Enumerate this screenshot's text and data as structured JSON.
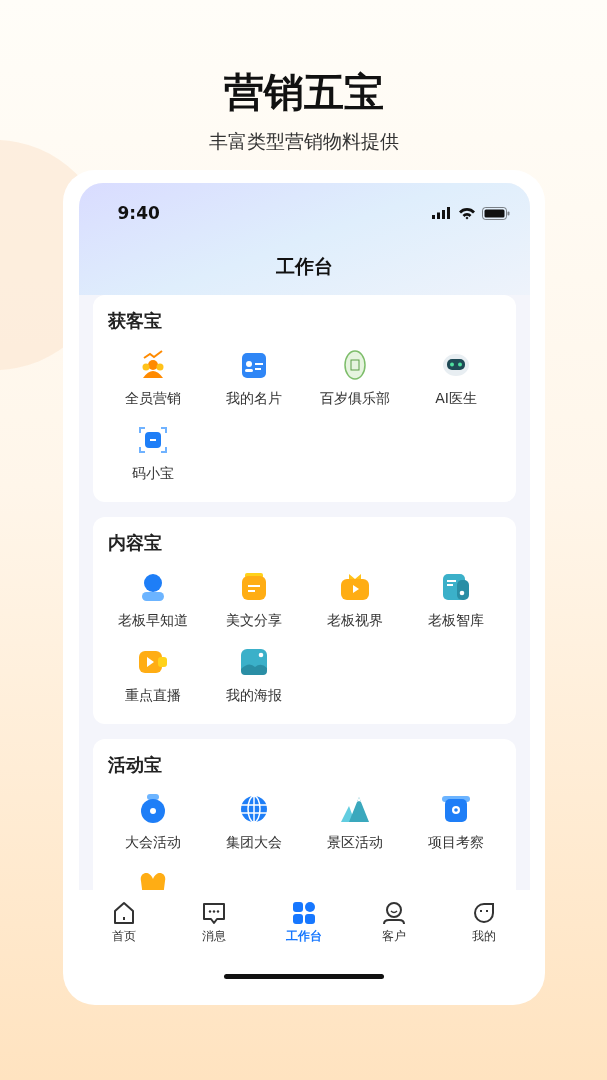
{
  "headline": "营销五宝",
  "subtitle": "丰富类型营销物料提供",
  "status_bar": {
    "time": "9:40"
  },
  "page_title": "工作台",
  "sections": [
    {
      "title": "获客宝",
      "items": [
        {
          "label": "全员营销"
        },
        {
          "label": "我的名片"
        },
        {
          "label": "百岁俱乐部"
        },
        {
          "label": "AI医生"
        },
        {
          "label": "码小宝"
        }
      ]
    },
    {
      "title": "内容宝",
      "items": [
        {
          "label": "老板早知道"
        },
        {
          "label": "美文分享"
        },
        {
          "label": "老板视界"
        },
        {
          "label": "老板智库"
        },
        {
          "label": "重点直播"
        },
        {
          "label": "我的海报"
        }
      ]
    },
    {
      "title": "活动宝",
      "items": [
        {
          "label": "大会活动"
        },
        {
          "label": "集团大会"
        },
        {
          "label": "景区活动"
        },
        {
          "label": "项目考察"
        }
      ]
    }
  ],
  "tabs": [
    {
      "label": "首页",
      "selected": false
    },
    {
      "label": "消息",
      "selected": false
    },
    {
      "label": "工作台",
      "selected": true
    },
    {
      "label": "客户",
      "selected": false
    },
    {
      "label": "我的",
      "selected": false
    }
  ]
}
